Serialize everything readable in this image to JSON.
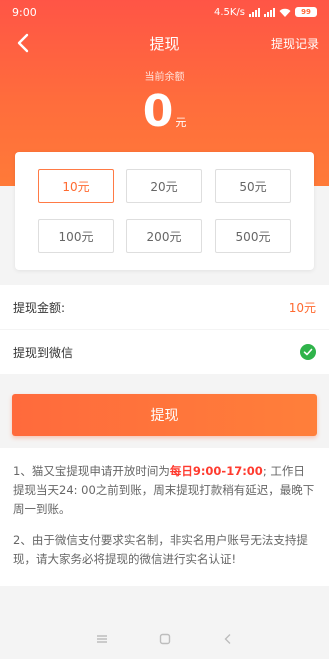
{
  "status": {
    "time": "9:00",
    "speed": "4.5K/s",
    "battery": "99"
  },
  "header": {
    "title": "提现",
    "history_label": "提现记录"
  },
  "balance": {
    "label": "当前余额",
    "value": "0",
    "unit": "元"
  },
  "amounts": [
    {
      "label": "10元",
      "selected": true
    },
    {
      "label": "20元",
      "selected": false
    },
    {
      "label": "50元",
      "selected": false
    },
    {
      "label": "100元",
      "selected": false
    },
    {
      "label": "200元",
      "selected": false
    },
    {
      "label": "500元",
      "selected": false
    }
  ],
  "withdraw_row": {
    "label": "提现金额:",
    "value": "10元"
  },
  "wechat_row": {
    "label": "提现到微信"
  },
  "submit_label": "提现",
  "notes": {
    "n1_pre": "1、猫又宝提现申请开放时间为",
    "n1_highlight": "每日9:00-17:00",
    "n1_post": "; 工作日提现当天24: 00之前到账，周末提现打款稍有延迟，最晚下周一到账。",
    "n2": "2、由于微信支付要求实名制，非实名用户账号无法支持提现，请大家务必将提现的微信进行实名认证!"
  },
  "colors": {
    "accent": "#ff6a3c",
    "highlight": "#ff3b2f",
    "success": "#2fb34a"
  }
}
